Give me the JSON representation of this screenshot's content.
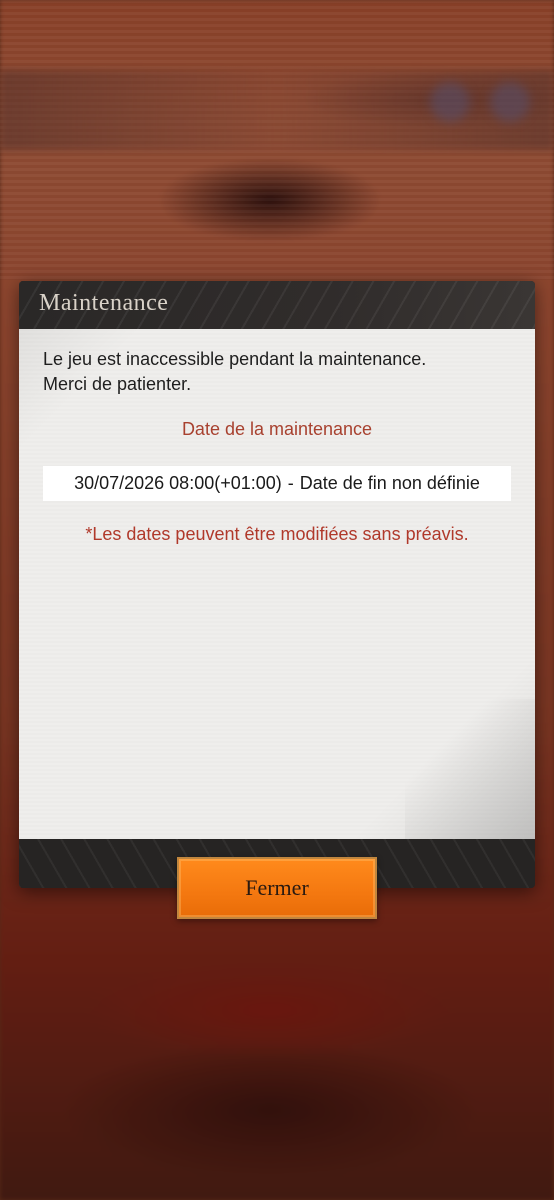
{
  "dialog": {
    "title": "Maintenance",
    "message_line1": "Le jeu est inaccessible pendant la maintenance.",
    "message_line2": "Merci de patienter.",
    "date_heading": "Date de la maintenance",
    "start_date": "30/07/2026 08:00(+01:00)",
    "separator": "-",
    "end_date": "Date de fin non définie",
    "notice": "*Les dates peuvent être modifiées sans préavis.",
    "close_label": "Fermer"
  },
  "colors": {
    "accent_red": "#a8412f",
    "button_orange": "#f47810",
    "header_dark": "#252322"
  }
}
